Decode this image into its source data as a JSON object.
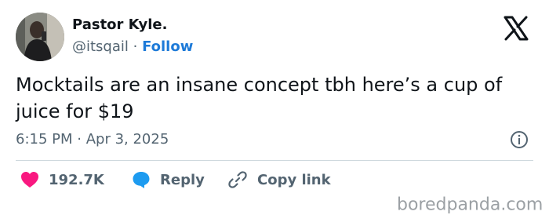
{
  "tweet": {
    "author_name": "Pastor Kyle.",
    "handle": "@itsqail",
    "separator": " · ",
    "follow_label": "Follow",
    "text": "Mocktails are an insane concept tbh here’s a cup of juice for $19",
    "time": "6:15 PM",
    "date_separator": " · ",
    "date": "Apr 3, 2025"
  },
  "actions": {
    "likes": "192.7K",
    "reply_label": "Reply",
    "copy_link_label": "Copy link"
  },
  "watermark": "boredpanda.com",
  "icons": {
    "logo": "x-logo-icon",
    "info": "info-icon",
    "like": "heart-icon",
    "reply": "speech-bubble-icon",
    "copy": "link-icon"
  },
  "colors": {
    "accent": "#1d7ad8",
    "like": "#f91880",
    "text": "#0f1419",
    "muted": "#536471"
  }
}
